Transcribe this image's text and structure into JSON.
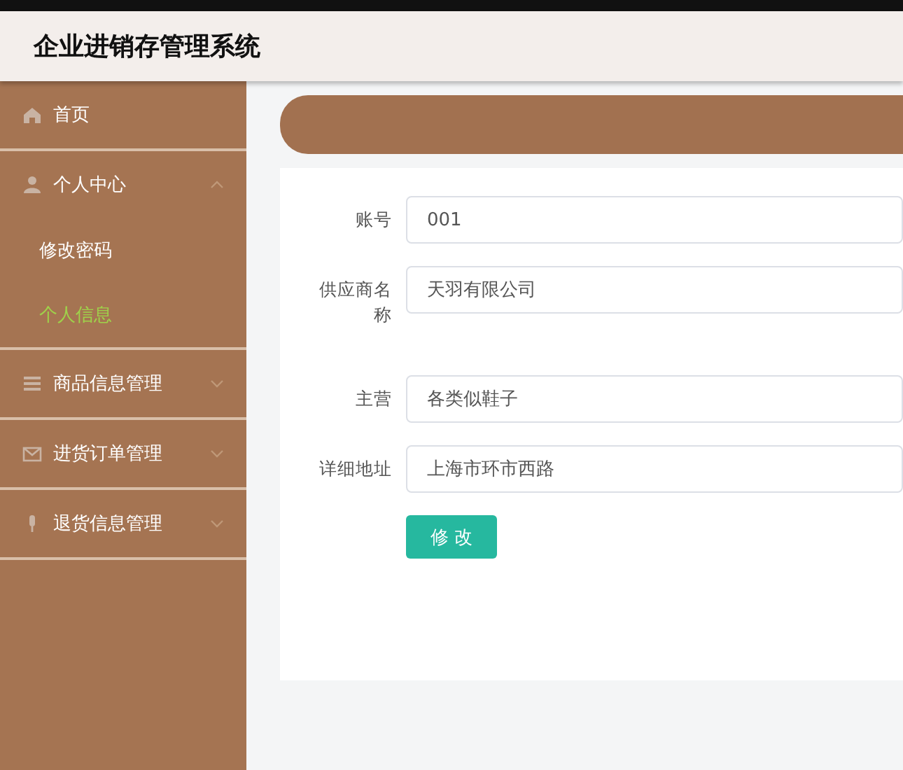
{
  "header": {
    "title": "企业进销存管理系统"
  },
  "sidebar": {
    "items": [
      {
        "label": "首页"
      },
      {
        "label": "个人中心",
        "expanded": true,
        "children": [
          {
            "label": "修改密码",
            "selected": false
          },
          {
            "label": "个人信息",
            "selected": true
          }
        ]
      },
      {
        "label": "商品信息管理",
        "expanded": false
      },
      {
        "label": "进货订单管理",
        "expanded": false
      },
      {
        "label": "退货信息管理",
        "expanded": false
      }
    ]
  },
  "form": {
    "fields": [
      {
        "label": "账号",
        "value": "001"
      },
      {
        "label": "供应商名称",
        "value": "天羽有限公司"
      },
      {
        "label": "主营",
        "value": "各类似鞋子"
      },
      {
        "label": "详细地址",
        "value": "上海市环市西路"
      }
    ],
    "submit": "修 改"
  }
}
